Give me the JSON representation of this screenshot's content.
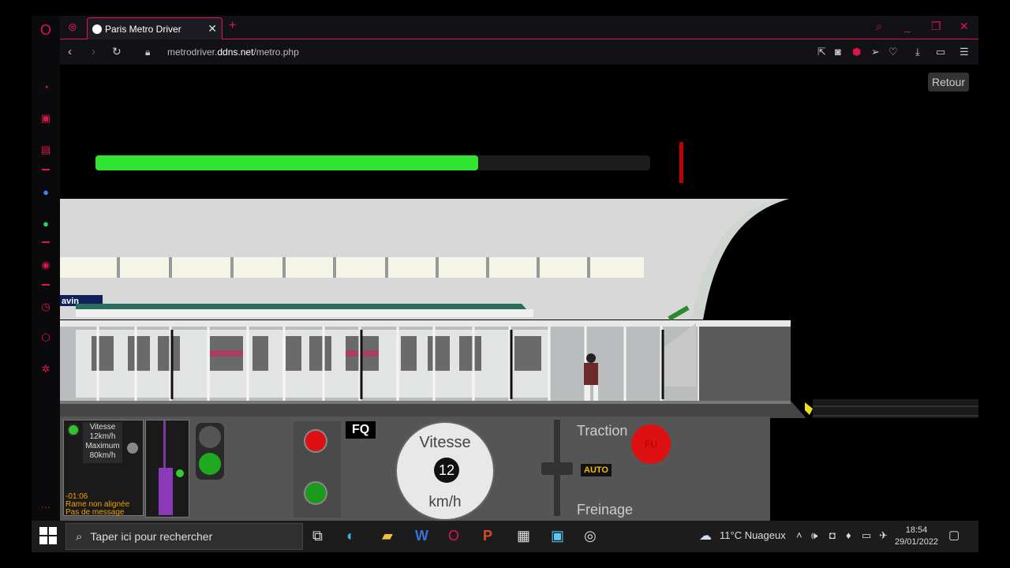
{
  "tab": {
    "title": "Paris Metro Driver"
  },
  "address": {
    "host_prefix": "metrodriver.",
    "host_domain": "ddns.net",
    "path": "/metro.php"
  },
  "page": {
    "back_button": "Retour",
    "station_progress": 0.69
  },
  "station_sign": "avin",
  "panel": {
    "speed_label": "Vitesse",
    "speed_value": "12km/h",
    "max_label": "Maximum",
    "max_value": "80km/h",
    "timer": "-01:06",
    "status_line_1": "Rame non alignée",
    "status_line_2": "Pas de message",
    "fq_label": "FQ",
    "speedo_label": "Vitesse",
    "speedo_value": "12",
    "speedo_unit": "km/h",
    "traction_label": "Traction",
    "freinage_label": "Freinage",
    "auto_label": "AUTO",
    "fu_label": "FU"
  },
  "taskbar": {
    "search_placeholder": "Taper ici pour rechercher",
    "weather": "11°C  Nuageux",
    "time": "18:54",
    "date": "29/01/2022"
  },
  "colors": {
    "accent": "#e0144c",
    "progress": "#33e533",
    "signal_green": "#1faa1f",
    "signal_red": "#d11"
  }
}
